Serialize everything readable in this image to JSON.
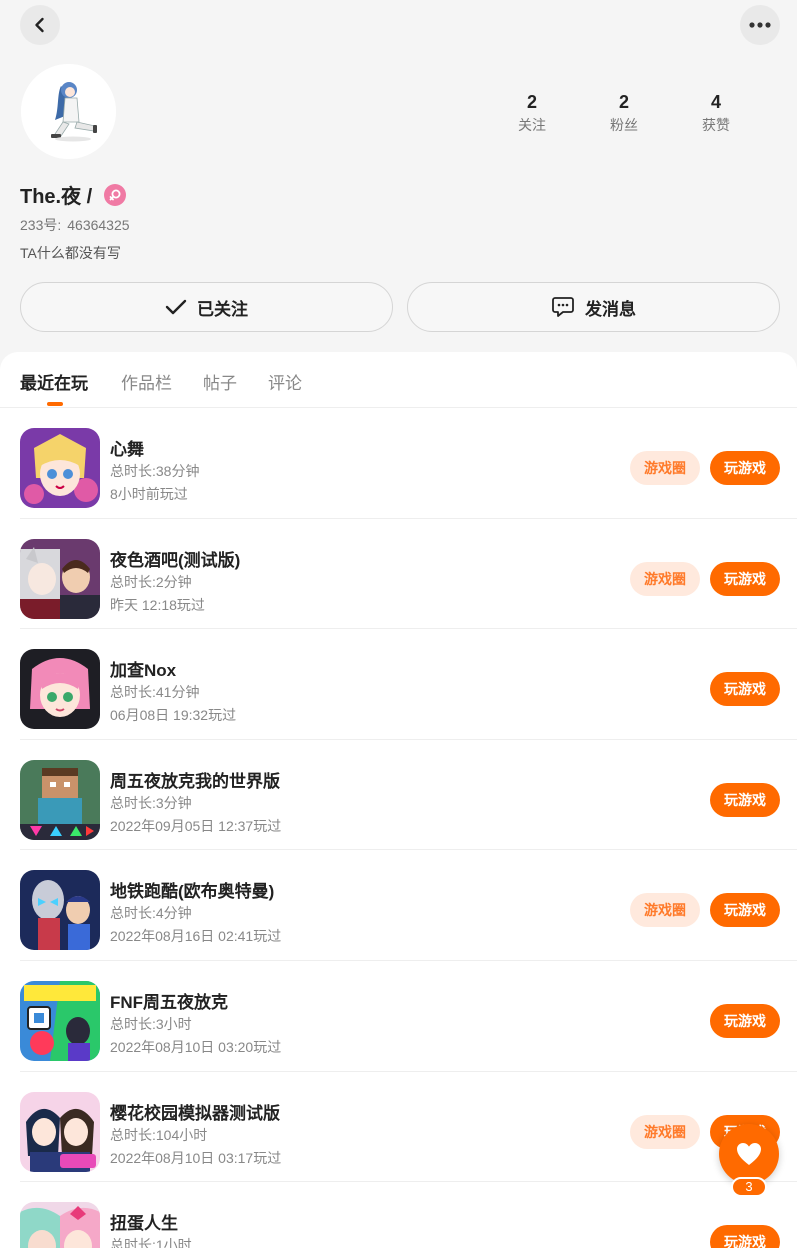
{
  "header": {
    "back_icon": "chevron-left-icon",
    "more_icon": "more-horizontal-icon"
  },
  "profile": {
    "username": "The.夜 /",
    "gender": "female",
    "id_label": "233号:",
    "id_value": "46364325",
    "bio": "TA什么都没有写",
    "stats": [
      {
        "value": "2",
        "label": "关注"
      },
      {
        "value": "2",
        "label": "粉丝"
      },
      {
        "value": "4",
        "label": "获赞"
      }
    ]
  },
  "actions": {
    "follow_label": "已关注",
    "message_label": "发消息"
  },
  "tabs": [
    {
      "label": "最近在玩",
      "active": true
    },
    {
      "label": "作品栏",
      "active": false
    },
    {
      "label": "帖子",
      "active": false
    },
    {
      "label": "评论",
      "active": false
    }
  ],
  "games": [
    {
      "name": "心舞",
      "duration": "总时长:38分钟",
      "last_played": "8小时前玩过",
      "has_circle": true
    },
    {
      "name": "夜色酒吧(测试版)",
      "duration": "总时长:2分钟",
      "last_played": "昨天 12:18玩过",
      "has_circle": true
    },
    {
      "name": "加查Nox",
      "duration": "总时长:41分钟",
      "last_played": "06月08日 19:32玩过",
      "has_circle": false
    },
    {
      "name": "周五夜放克我的世界版",
      "duration": "总时长:3分钟",
      "last_played": "2022年09月05日 12:37玩过",
      "has_circle": false
    },
    {
      "name": "地铁跑酷(欧布奥特曼)",
      "duration": "总时长:4分钟",
      "last_played": "2022年08月16日 02:41玩过",
      "has_circle": true
    },
    {
      "name": "FNF周五夜放克",
      "duration": "总时长:3小时",
      "last_played": "2022年08月10日 03:20玩过",
      "has_circle": false
    },
    {
      "name": "樱花校园模拟器测试版",
      "duration": "总时长:104小时",
      "last_played": "2022年08月10日 03:17玩过",
      "has_circle": true
    },
    {
      "name": "扭蛋人生",
      "duration": "总时长:1小时",
      "last_played": "",
      "has_circle": false
    }
  ],
  "game_buttons": {
    "circle_label": "游戏圈",
    "play_label": "玩游戏"
  },
  "like": {
    "count": "3"
  },
  "colors": {
    "accent": "#ff6a00",
    "chip_bg": "#ffe9dd",
    "gender_pink": "#f07aa4"
  }
}
